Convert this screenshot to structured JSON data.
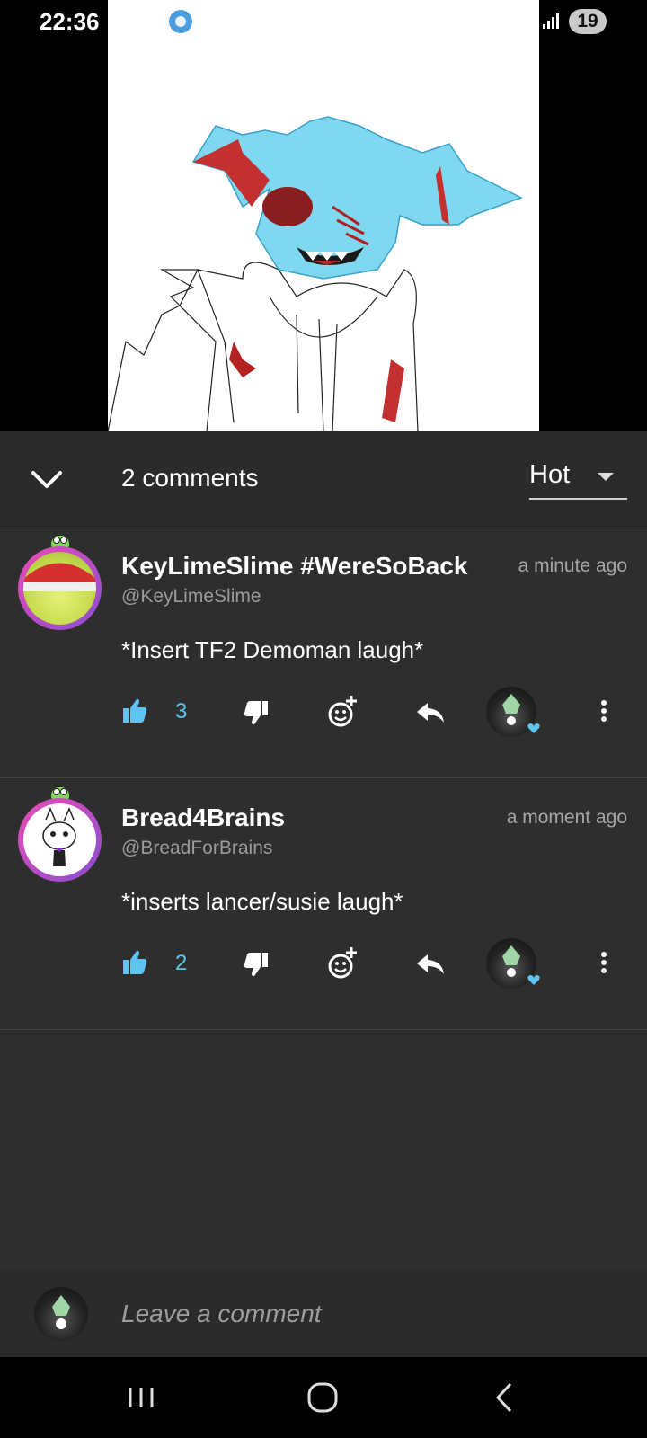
{
  "status_bar": {
    "time": "22:36",
    "battery": "19",
    "icons": [
      "app-notification-icon",
      "signal-icon",
      "battery-icon"
    ]
  },
  "comments_header": {
    "count_label": "2 comments",
    "sort_value": "Hot",
    "collapse_icon": "chevron-down-icon",
    "sort_icon": "caret-down-icon"
  },
  "comments": [
    {
      "author": "KeyLimeSlime #WereSoBack",
      "handle": "@KeyLimeSlime",
      "time": "a minute ago",
      "body": "*Insert TF2 Demoman laugh*",
      "likes": "3"
    },
    {
      "author": "Bread4Brains",
      "handle": "@BreadForBrains",
      "time": "a moment ago",
      "body": "*inserts lancer/susie laugh*",
      "likes": "2"
    }
  ],
  "comment_input": {
    "placeholder": "Leave a comment"
  },
  "colors": {
    "accent": "#5ec4f2",
    "panel": "#2e2e2e",
    "header": "#2b2b2b",
    "avatar_ring": "#c94fc9"
  },
  "nav_bar": {
    "icons": [
      "recent-apps-icon",
      "home-icon",
      "back-icon"
    ]
  }
}
